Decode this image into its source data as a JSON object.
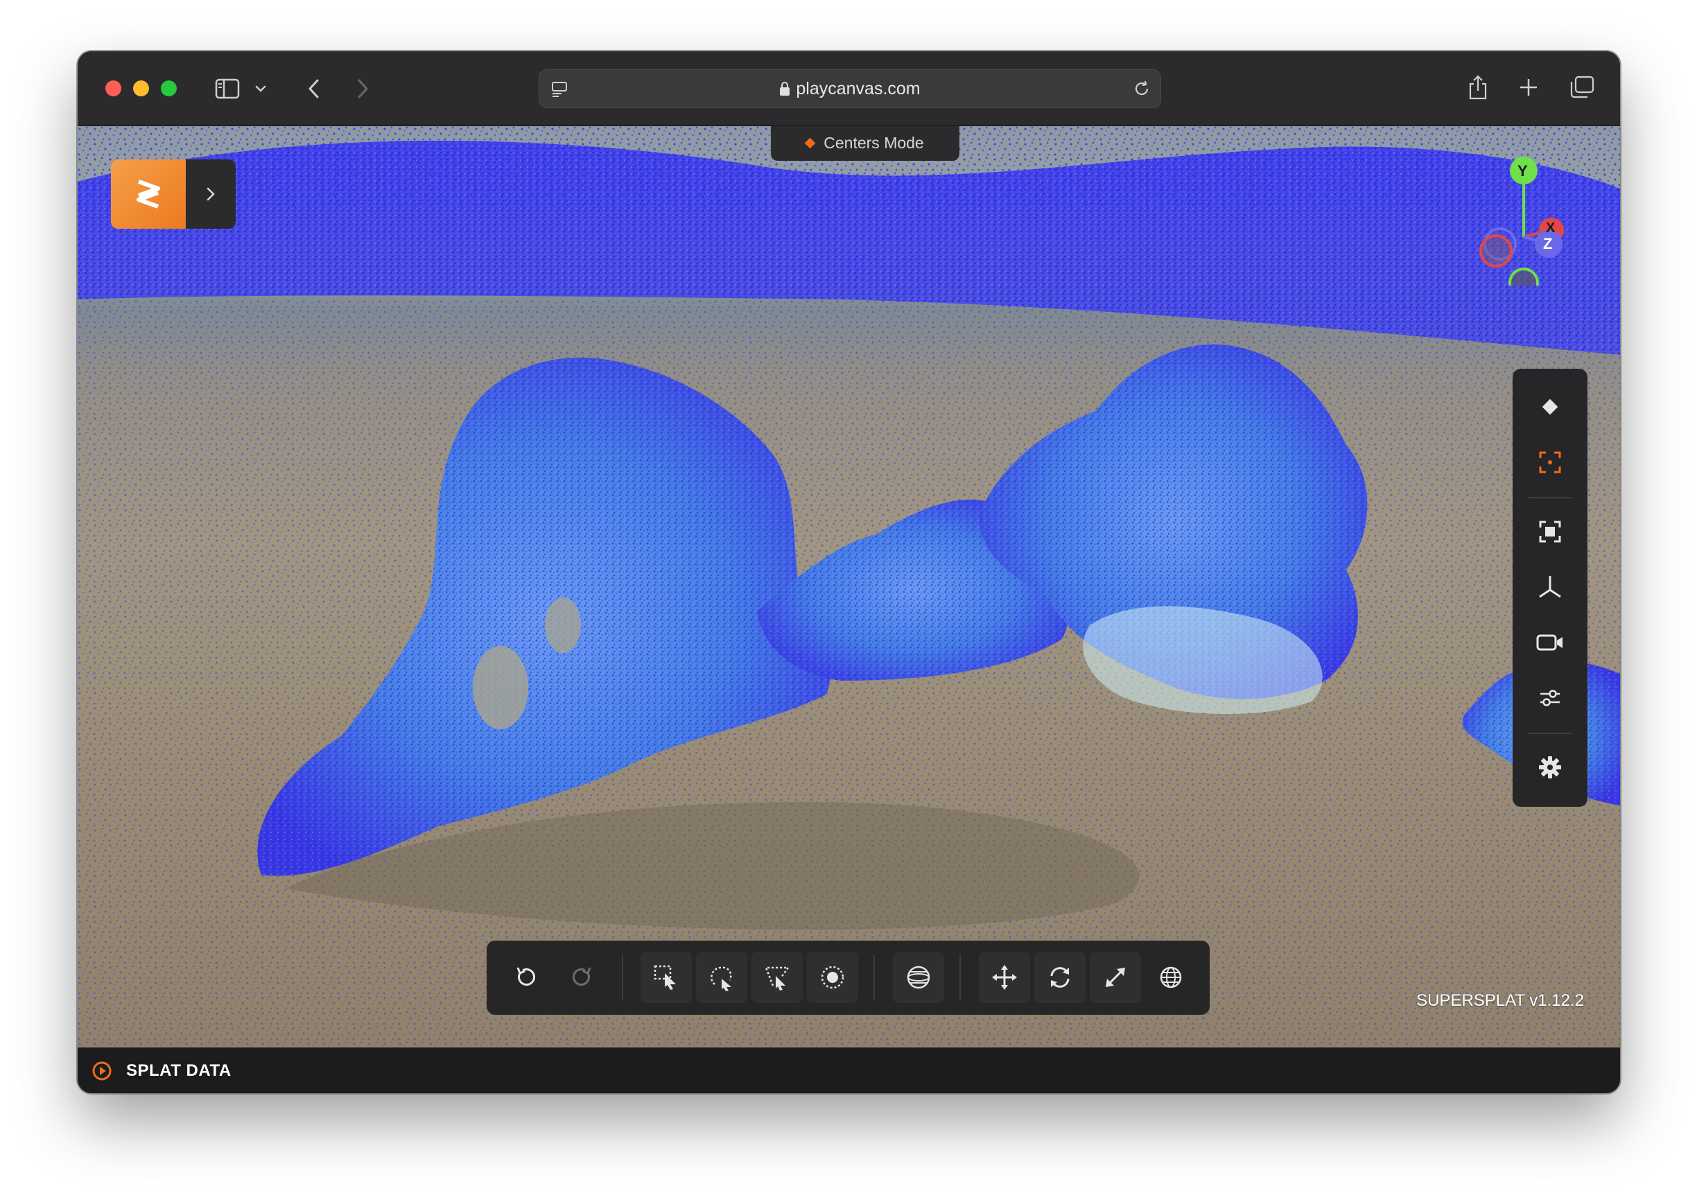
{
  "browser": {
    "url": "playcanvas.com",
    "icons": [
      "sidebar-icon",
      "chevron-down-icon",
      "back-icon",
      "forward-icon",
      "reader-icon",
      "lock-icon",
      "reload-icon",
      "share-icon",
      "new-tab-icon",
      "tabs-overview-icon"
    ]
  },
  "app": {
    "mode_label": "Centers Mode",
    "version": "SUPERSPLAT v1.12.2",
    "panel_title": "SPLAT DATA",
    "accent_color": "#f26b1d"
  },
  "gizmo": {
    "axes": [
      "Y",
      "X",
      "Z"
    ],
    "colors": {
      "y": "#6ee04a",
      "x": "#e04848",
      "z": "#6a6ae8"
    }
  },
  "right_toolbar": {
    "items": [
      "splat-mode-icon",
      "centers-mode-icon",
      "frame-selection-icon",
      "axes-icon",
      "camera-icon",
      "color-adjust-icon",
      "settings-icon"
    ],
    "active": "centers-mode-icon"
  },
  "bottom_toolbar": {
    "items": [
      "undo-icon",
      "redo-icon",
      "rect-select-icon",
      "lasso-select-icon",
      "polygon-select-icon",
      "brush-select-icon",
      "sphere-select-icon",
      "move-icon",
      "rotate-icon",
      "scale-icon",
      "world-space-icon"
    ]
  },
  "scene": {
    "point_color": "#2f2ff0",
    "highlight_color": "#5fd6e6"
  }
}
